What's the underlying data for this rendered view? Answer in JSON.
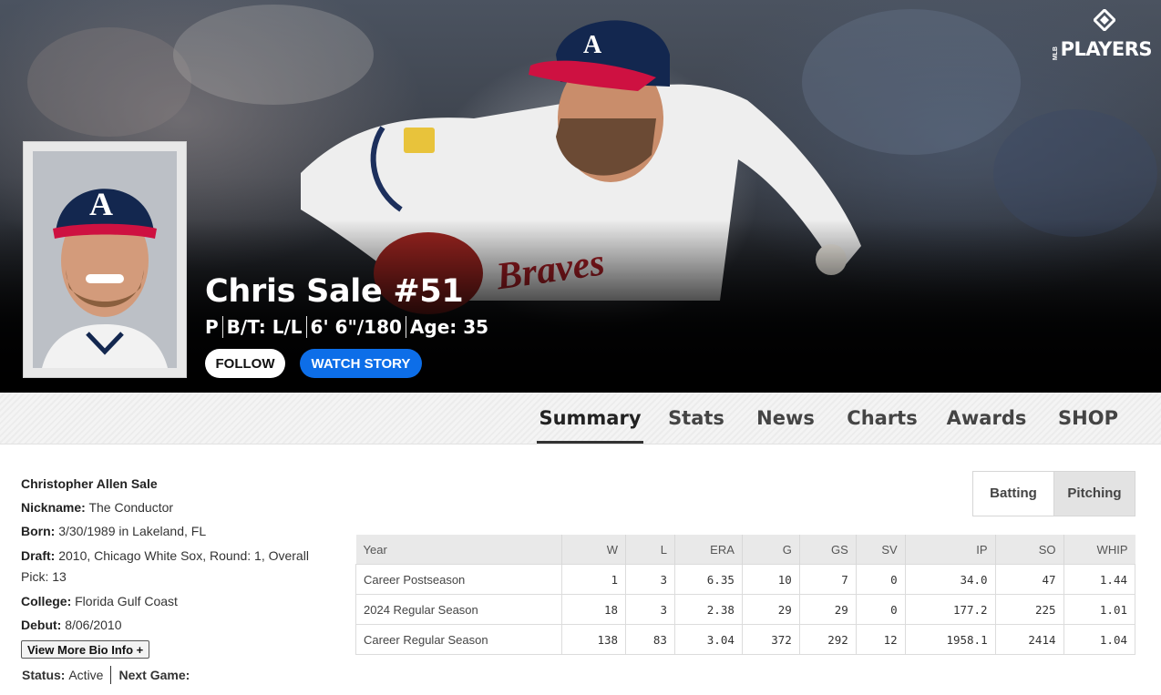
{
  "brand": {
    "mlb": "MLB",
    "name": "PLAYERS"
  },
  "player": {
    "name": "Chris Sale #51",
    "position": "P",
    "bats_throws": "B/T: L/L",
    "height_weight": "6' 6\"/180",
    "age": "Age: 35"
  },
  "actions": {
    "follow": "FOLLOW",
    "watch_story": "WATCH STORY"
  },
  "tabs": [
    "Summary",
    "Stats",
    "News",
    "Charts",
    "Awards",
    "SHOP"
  ],
  "bio": {
    "full_name": "Christopher Allen Sale",
    "nickname_label": "Nickname:",
    "nickname": "The Conductor",
    "born_label": "Born:",
    "born": "3/30/1989 in Lakeland, FL",
    "draft_label": "Draft:",
    "draft": "2010, Chicago White Sox, Round: 1, Overall Pick: 13",
    "college_label": "College:",
    "college": "Florida Gulf Coast",
    "debut_label": "Debut:",
    "debut": "8/06/2010",
    "more_button": "View More Bio Info +",
    "status_label": "Status:",
    "status": "Active",
    "next_game_label": "Next Game:"
  },
  "toggle": {
    "batting": "Batting",
    "pitching": "Pitching"
  },
  "stats_table": {
    "headers": [
      "Year",
      "W",
      "L",
      "ERA",
      "G",
      "GS",
      "SV",
      "IP",
      "SO",
      "WHIP"
    ],
    "rows": [
      [
        "Career Postseason",
        "1",
        "3",
        "6.35",
        "10",
        "7",
        "0",
        "34.0",
        "47",
        "1.44"
      ],
      [
        "2024 Regular Season",
        "18",
        "3",
        "2.38",
        "29",
        "29",
        "0",
        "177.2",
        "225",
        "1.01"
      ],
      [
        "Career Regular Season",
        "138",
        "83",
        "3.04",
        "372",
        "292",
        "12",
        "1958.1",
        "2414",
        "1.04"
      ]
    ]
  },
  "colors": {
    "accent_blue": "#0d6ee8",
    "braves_navy": "#13274f",
    "braves_red": "#ce1141"
  }
}
